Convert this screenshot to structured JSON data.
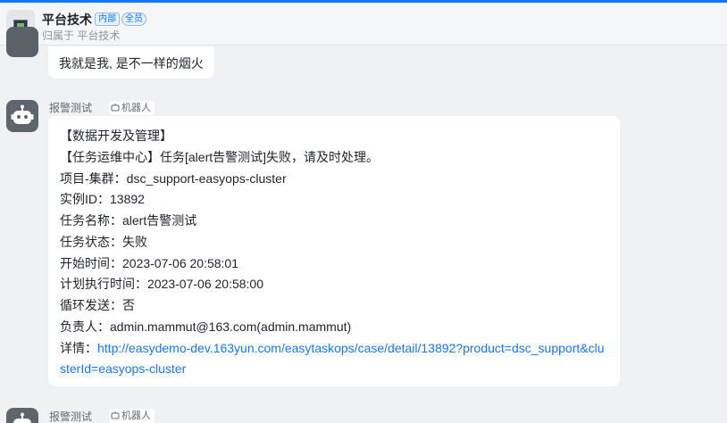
{
  "header": {
    "group_name": "平台技术",
    "tags": [
      "内部",
      "全员"
    ],
    "subtitle": "归属于 平台技术"
  },
  "previous_message": {
    "text": "我就是我, 是不一样的烟火"
  },
  "bot_message": {
    "sender": "报警测试",
    "badge": "机器人",
    "lines": [
      "【数据开发及管理】",
      "【任务运维中心】任务[alert告警测试]失败，请及时处理。",
      "项目-集群：dsc_support-easyops-cluster",
      "实例ID：13892",
      "任务名称：alert告警测试",
      "任务状态：失败",
      "开始时间：2023-07-06 20:58:01",
      "计划执行时间：2023-07-06 20:58:00",
      "循环发送：否",
      "负责人：admin.mammut@163.com(admin.mammut)"
    ],
    "detail_label": "详情：",
    "detail_link": "http://easydemo-dev.163yun.com/easytaskops/case/detail/13892?product=dsc_support&clusterId=easyops-cluster"
  },
  "next_message": {
    "sender": "报警测试",
    "badge": "机器人"
  },
  "icons": {
    "group_avatar": "screen-avatar-icon",
    "bot_avatar": "robot-avatar-icon",
    "badge_icon": "robot-small-icon"
  },
  "colors": {
    "accent": "#1677ff",
    "link": "#1677ff",
    "background": "#f0f1f3",
    "bubble": "#ffffff"
  }
}
